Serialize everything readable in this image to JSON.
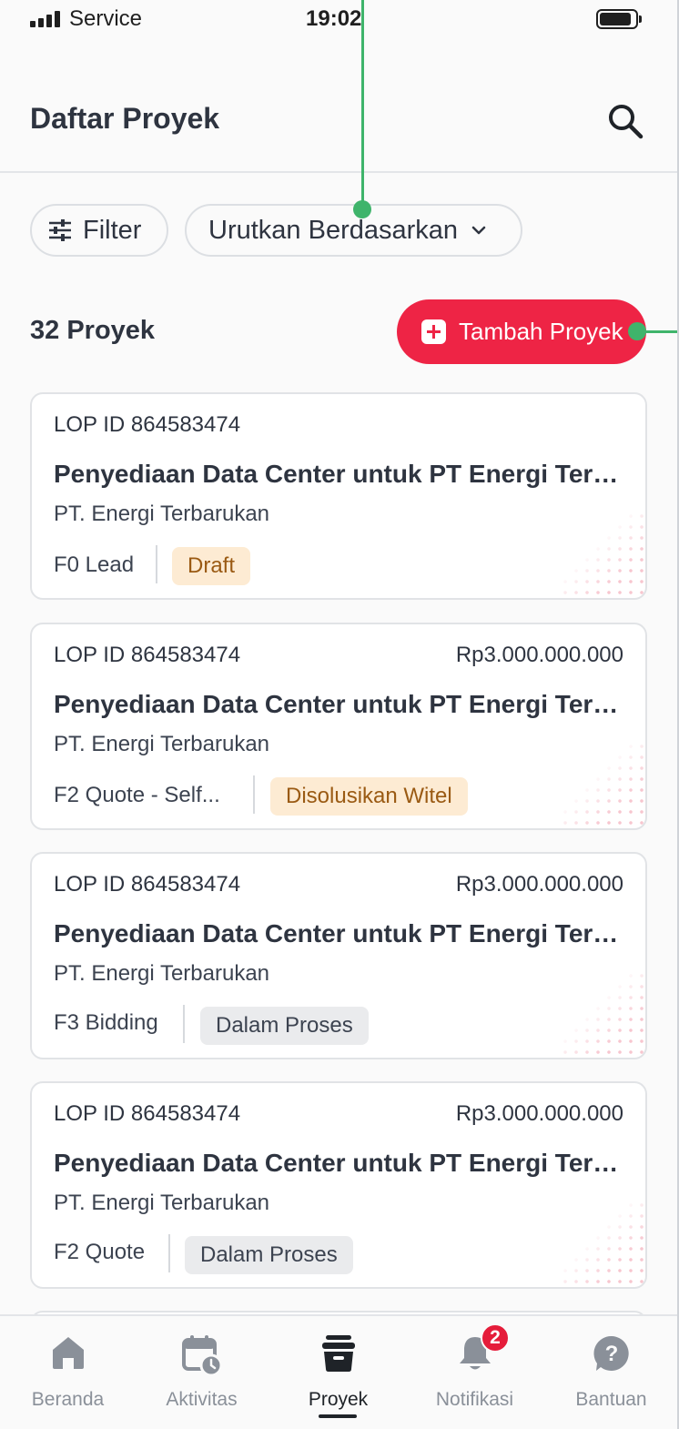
{
  "status_bar": {
    "carrier": "Service",
    "time": "19:02"
  },
  "header": {
    "title": "Daftar Proyek"
  },
  "toolbar": {
    "filter_label": "Filter",
    "sort_label": "Urutkan Berdasarkan"
  },
  "summary": {
    "count_label": "32 Proyek",
    "add_label": "Tambah Proyek"
  },
  "colors": {
    "accent": "#ee2445",
    "connector": "#3fb46b",
    "badge_orange_bg": "#fdebd3",
    "badge_gray_bg": "#eaebed"
  },
  "projects": [
    {
      "lop": "LOP ID 864583474",
      "amount": "",
      "title": "Penyediaan Data Center untuk PT Energi Terbarukan",
      "company": "PT. Energi Terbarukan",
      "stage": "F0 Lead",
      "status": "Draft",
      "status_style": "orange"
    },
    {
      "lop": "LOP ID 864583474",
      "amount": "Rp3.000.000.000",
      "title": "Penyediaan Data Center untuk PT Energi Terbarukan",
      "company": "PT. Energi Terbarukan",
      "stage": "F2 Quote - Self...",
      "status": "Disolusikan Witel",
      "status_style": "orange"
    },
    {
      "lop": "LOP ID 864583474",
      "amount": "Rp3.000.000.000",
      "title": "Penyediaan Data Center untuk PT Energi Terbarukan",
      "company": "PT. Energi Terbarukan",
      "stage": "F3 Bidding",
      "status": "Dalam Proses",
      "status_style": "gray"
    },
    {
      "lop": "LOP ID 864583474",
      "amount": "Rp3.000.000.000",
      "title": "Penyediaan Data Center untuk PT Energi Terbarukan",
      "company": "PT. Energi Terbarukan",
      "stage": "F2 Quote",
      "status": "Dalam Proses",
      "status_style": "gray"
    }
  ],
  "nav": {
    "items": [
      {
        "label": "Beranda",
        "icon": "home-icon"
      },
      {
        "label": "Aktivitas",
        "icon": "calendar-clock-icon"
      },
      {
        "label": "Proyek",
        "icon": "project-box-icon"
      },
      {
        "label": "Notifikasi",
        "icon": "bell-icon"
      },
      {
        "label": "Bantuan",
        "icon": "help-icon"
      }
    ],
    "active_index": 2,
    "notification_count": "2"
  }
}
